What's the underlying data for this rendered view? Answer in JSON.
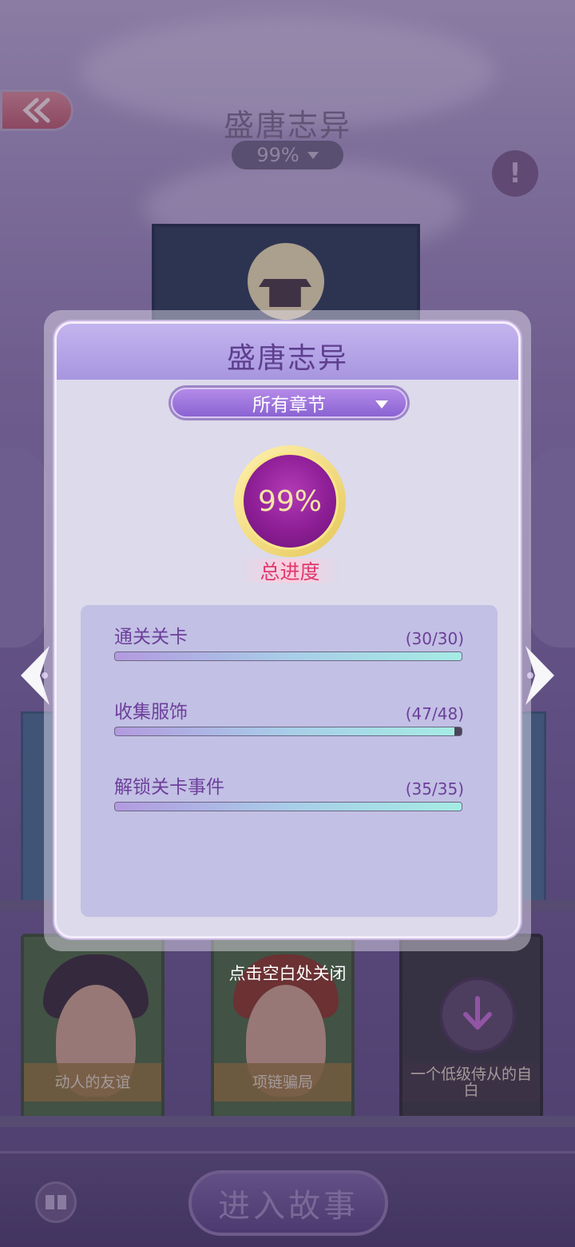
{
  "background": {
    "story_title": "盛唐志异",
    "story_progress": "99%",
    "enter_button": "进入故事",
    "story_cards": [
      {
        "label": "动人的友谊"
      },
      {
        "label": "项链骗局"
      },
      {
        "label": "一个低级侍从的自白"
      }
    ]
  },
  "modal": {
    "title": "盛唐志异",
    "chapter_select": "所有章节",
    "total_progress_value": "99%",
    "total_progress_label": "总进度",
    "total_progress_fraction": 0.99,
    "stats": [
      {
        "name": "通关关卡",
        "count": "(30/30)",
        "fraction": 1.0
      },
      {
        "name": "收集服饰",
        "count": "(47/48)",
        "fraction": 0.979
      },
      {
        "name": "解锁关卡事件",
        "count": "(35/35)",
        "fraction": 1.0
      }
    ]
  },
  "close_hint": "点击空白处关闭",
  "icons": [
    "double-chevron-left-icon",
    "chevron-down-icon",
    "exclamation-icon",
    "download-arrow-icon",
    "book-settings-icon",
    "arrow-left-icon",
    "arrow-right-icon"
  ],
  "colors": {
    "accent": "#8a63d2",
    "progress_text": "#e0386e",
    "title": "#5e3f8f"
  }
}
